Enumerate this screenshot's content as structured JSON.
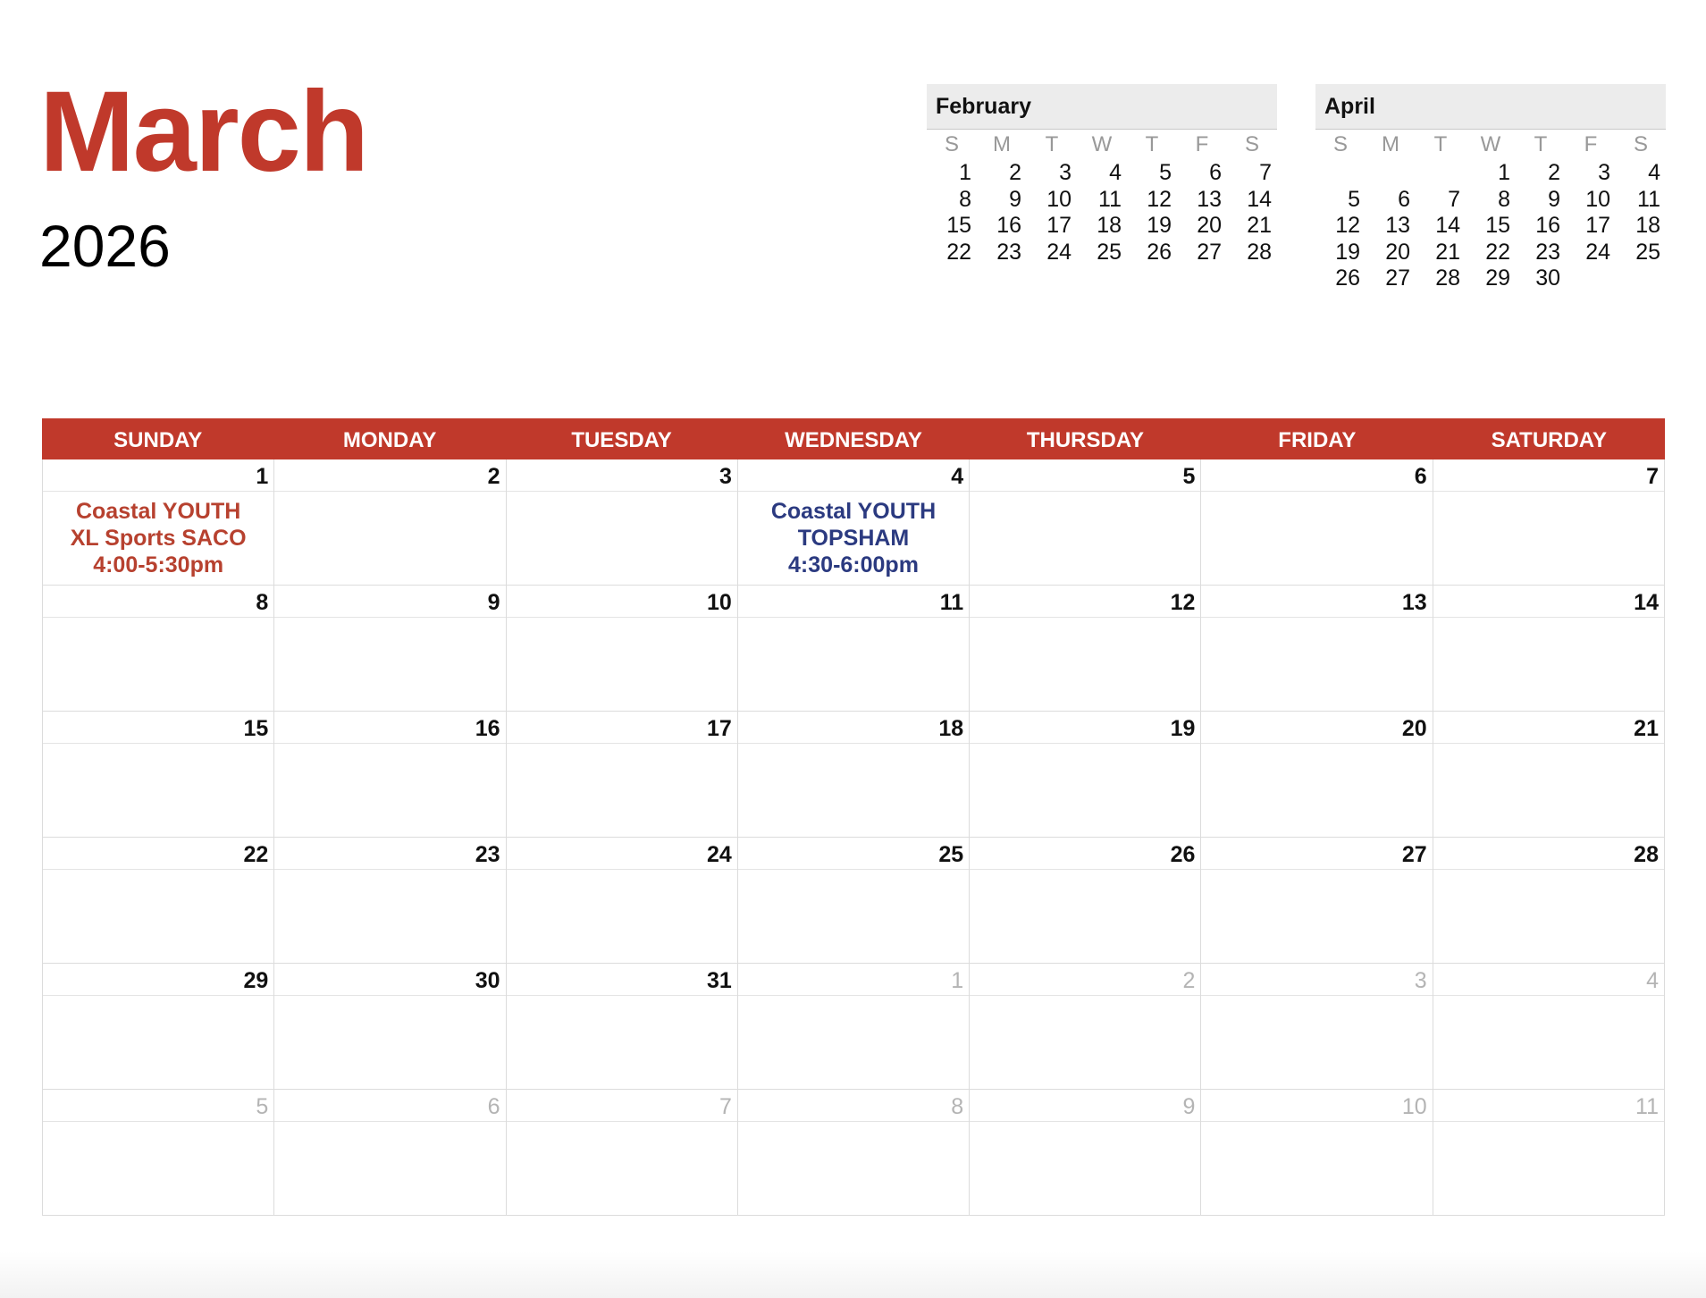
{
  "title": {
    "month": "March",
    "year": "2026"
  },
  "mini_calendars": [
    {
      "month": "February",
      "weekdays": [
        "S",
        "M",
        "T",
        "W",
        "T",
        "F",
        "S"
      ],
      "weeks": [
        [
          "1",
          "2",
          "3",
          "4",
          "5",
          "6",
          "7"
        ],
        [
          "8",
          "9",
          "10",
          "11",
          "12",
          "13",
          "14"
        ],
        [
          "15",
          "16",
          "17",
          "18",
          "19",
          "20",
          "21"
        ],
        [
          "22",
          "23",
          "24",
          "25",
          "26",
          "27",
          "28"
        ]
      ]
    },
    {
      "month": "April",
      "weekdays": [
        "S",
        "M",
        "T",
        "W",
        "T",
        "F",
        "S"
      ],
      "weeks": [
        [
          "",
          "",
          "",
          "1",
          "2",
          "3",
          "4"
        ],
        [
          "5",
          "6",
          "7",
          "8",
          "9",
          "10",
          "11"
        ],
        [
          "12",
          "13",
          "14",
          "15",
          "16",
          "17",
          "18"
        ],
        [
          "19",
          "20",
          "21",
          "22",
          "23",
          "24",
          "25"
        ],
        [
          "26",
          "27",
          "28",
          "29",
          "30",
          "",
          ""
        ]
      ]
    }
  ],
  "calendar": {
    "day_names": [
      "SUNDAY",
      "MONDAY",
      "TUESDAY",
      "WEDNESDAY",
      "THURSDAY",
      "FRIDAY",
      "SATURDAY"
    ],
    "weeks": [
      [
        {
          "day": "1",
          "current": true,
          "event": {
            "text": "Coastal YOUTH\nXL Sports SACO\n4:00-5:30pm",
            "color": "#b7412f"
          }
        },
        {
          "day": "2",
          "current": true
        },
        {
          "day": "3",
          "current": true
        },
        {
          "day": "4",
          "current": true,
          "event": {
            "text": "Coastal YOUTH\nTOPSHAM\n4:30-6:00pm",
            "color": "#2b3a80"
          }
        },
        {
          "day": "5",
          "current": true
        },
        {
          "day": "6",
          "current": true
        },
        {
          "day": "7",
          "current": true
        }
      ],
      [
        {
          "day": "8",
          "current": true
        },
        {
          "day": "9",
          "current": true
        },
        {
          "day": "10",
          "current": true
        },
        {
          "day": "11",
          "current": true
        },
        {
          "day": "12",
          "current": true
        },
        {
          "day": "13",
          "current": true
        },
        {
          "day": "14",
          "current": true
        }
      ],
      [
        {
          "day": "15",
          "current": true
        },
        {
          "day": "16",
          "current": true
        },
        {
          "day": "17",
          "current": true
        },
        {
          "day": "18",
          "current": true
        },
        {
          "day": "19",
          "current": true
        },
        {
          "day": "20",
          "current": true
        },
        {
          "day": "21",
          "current": true
        }
      ],
      [
        {
          "day": "22",
          "current": true
        },
        {
          "day": "23",
          "current": true
        },
        {
          "day": "24",
          "current": true
        },
        {
          "day": "25",
          "current": true
        },
        {
          "day": "26",
          "current": true
        },
        {
          "day": "27",
          "current": true
        },
        {
          "day": "28",
          "current": true
        }
      ],
      [
        {
          "day": "29",
          "current": true
        },
        {
          "day": "30",
          "current": true
        },
        {
          "day": "31",
          "current": true
        },
        {
          "day": "1",
          "current": false
        },
        {
          "day": "2",
          "current": false
        },
        {
          "day": "3",
          "current": false
        },
        {
          "day": "4",
          "current": false
        }
      ],
      [
        {
          "day": "5",
          "current": false
        },
        {
          "day": "6",
          "current": false
        },
        {
          "day": "7",
          "current": false
        },
        {
          "day": "8",
          "current": false
        },
        {
          "day": "9",
          "current": false
        },
        {
          "day": "10",
          "current": false
        },
        {
          "day": "11",
          "current": false
        }
      ]
    ]
  },
  "colors": {
    "accent": "#c0392b",
    "event_saco": "#b7412f",
    "event_topsham": "#2b3a80",
    "muted_day": "#b4b4b4"
  }
}
